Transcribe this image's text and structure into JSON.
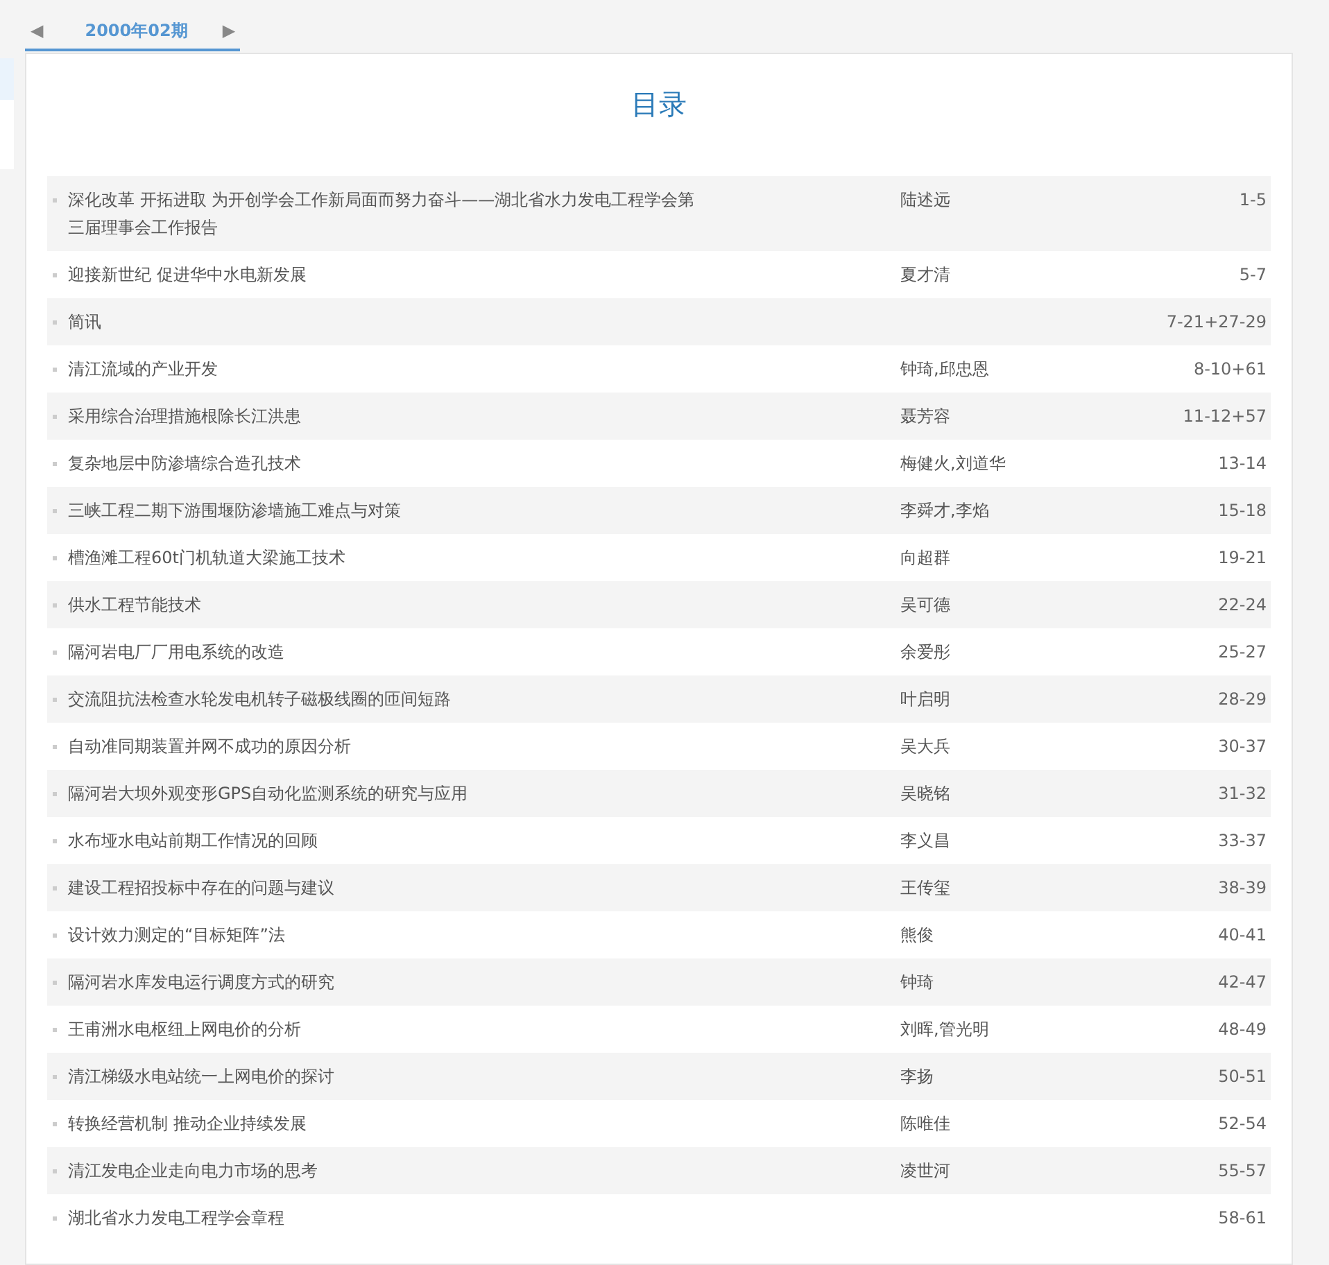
{
  "issue_nav": {
    "prev": "◀",
    "tab": {
      "label": "2000年02期",
      "selected": true
    },
    "next": "▶"
  },
  "toc": {
    "title": "目录",
    "items": [
      {
        "title": "深化改革 开拓进取 为开创学会工作新局面而努力奋斗——湖北省水力发电工程学会第三届理事会工作报告",
        "author": "陆述远",
        "pages": "1-5"
      },
      {
        "title": "迎接新世纪 促进华中水电新发展",
        "author": "夏才清",
        "pages": "5-7"
      },
      {
        "title": "简讯",
        "pages": "7-21+27-29"
      },
      {
        "title": "清江流域的产业开发",
        "author": "钟琦,邱忠恩",
        "pages": "8-10+61"
      },
      {
        "title": "采用综合治理措施根除长江洪患",
        "author": "聂芳容",
        "pages": "11-12+57"
      },
      {
        "title": "复杂地层中防渗墙综合造孔技术",
        "author": "梅健火,刘道华",
        "pages": "13-14"
      },
      {
        "title": "三峡工程二期下游围堰防渗墙施工难点与对策",
        "author": "李舜才,李焰",
        "pages": "15-18"
      },
      {
        "title": "槽渔滩工程60t门机轨道大梁施工技术",
        "author": "向超群",
        "pages": "19-21"
      },
      {
        "title": "供水工程节能技术",
        "author": "吴可德",
        "pages": "22-24"
      },
      {
        "title": "隔河岩电厂厂用电系统的改造",
        "author": "余爱彤",
        "pages": "25-27"
      },
      {
        "title": "交流阻抗法检查水轮发电机转子磁极线圈的匝间短路",
        "author": "叶启明",
        "pages": "28-29"
      },
      {
        "title": "自动准同期装置并网不成功的原因分析",
        "author": "吴大兵",
        "pages": "30-37"
      },
      {
        "title": "隔河岩大坝外观变形GPS自动化监测系统的研究与应用",
        "author": "吴晓铭",
        "pages": "31-32"
      },
      {
        "title": "水布垭水电站前期工作情况的回顾",
        "author": "李义昌",
        "pages": "33-37"
      },
      {
        "title": "建设工程招投标中存在的问题与建议",
        "author": "王传玺",
        "pages": "38-39"
      },
      {
        "title": "设计效力测定的“目标矩阵”法",
        "author": "熊俊",
        "pages": "40-41"
      },
      {
        "title": "隔河岩水库发电运行调度方式的研究",
        "author": "钟琦",
        "pages": "42-47"
      },
      {
        "title": "王甫洲水电枢纽上网电价的分析",
        "author": "刘晖,管光明",
        "pages": "48-49"
      },
      {
        "title": "清江梯级水电站统一上网电价的探讨",
        "author": "李扬",
        "pages": "50-51"
      },
      {
        "title": "转换经营机制 推动企业持续发展",
        "author": "陈唯佳",
        "pages": "52-54"
      },
      {
        "title": "清江发电企业走向电力市场的思考",
        "author": "凌世河",
        "pages": "55-57"
      },
      {
        "title": "湖北省水力发电工程学会章程",
        "pages": "58-61"
      }
    ]
  }
}
